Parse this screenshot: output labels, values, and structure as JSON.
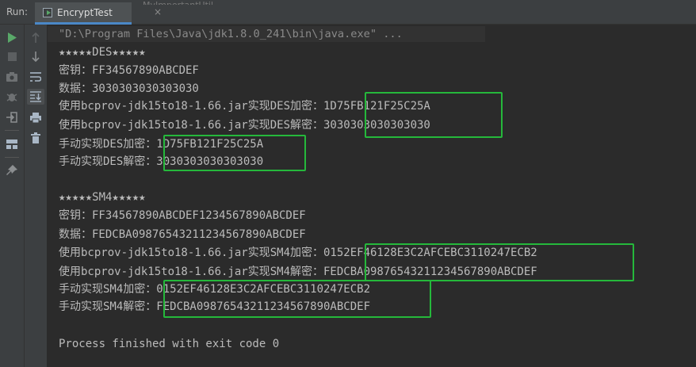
{
  "run_panel": {
    "label": "Run:",
    "tab_title": "EncryptTest",
    "tab_close": "×",
    "faded_tab_title": "MyImportantUtil"
  },
  "console": {
    "lines": [
      "\"D:\\Program Files\\Java\\jdk1.8.0_241\\bin\\java.exe\" ...",
      "★★★★★DES★★★★★",
      "密钥：FF34567890ABCDEF",
      "数据：3030303030303030",
      "使用bcprov-jdk15to18-1.66.jar实现DES加密：1D75FB121F25C25A",
      "使用bcprov-jdk15to18-1.66.jar实现DES解密：3030303030303030",
      "手动实现DES加密：1D75FB121F25C25A",
      "手动实现DES解密：3030303030303030",
      "",
      "★★★★★SM4★★★★★",
      "密钥：FF34567890ABCDEF1234567890ABCDEF",
      "数据：FEDCBA09876543211234567890ABCDEF",
      "使用bcprov-jdk15to18-1.66.jar实现SM4加密：0152EF46128E3C2AFCEBC3110247ECB2",
      "使用bcprov-jdk15to18-1.66.jar实现SM4解密：FEDCBA09876543211234567890ABCDEF",
      "手动实现SM4加密：0152EF46128E3C2AFCEBC3110247ECB2",
      "手动实现SM4解密：FEDCBA09876543211234567890ABCDEF",
      "",
      "Process finished with exit code 0"
    ]
  },
  "colors": {
    "background": "#2b2b2b",
    "text": "#bbbbbb",
    "highlight_box": "#25b83b",
    "run_icon": "#59a869"
  },
  "toolbar_icons": [
    "run-icon",
    "stop-icon",
    "camera-icon",
    "debug-icon",
    "login-icon",
    "layout-icon",
    "pin-icon",
    "up-arrow-icon",
    "down-arrow-icon",
    "soft-wrap-icon",
    "scroll-to-end-icon",
    "print-icon",
    "trash-icon"
  ]
}
